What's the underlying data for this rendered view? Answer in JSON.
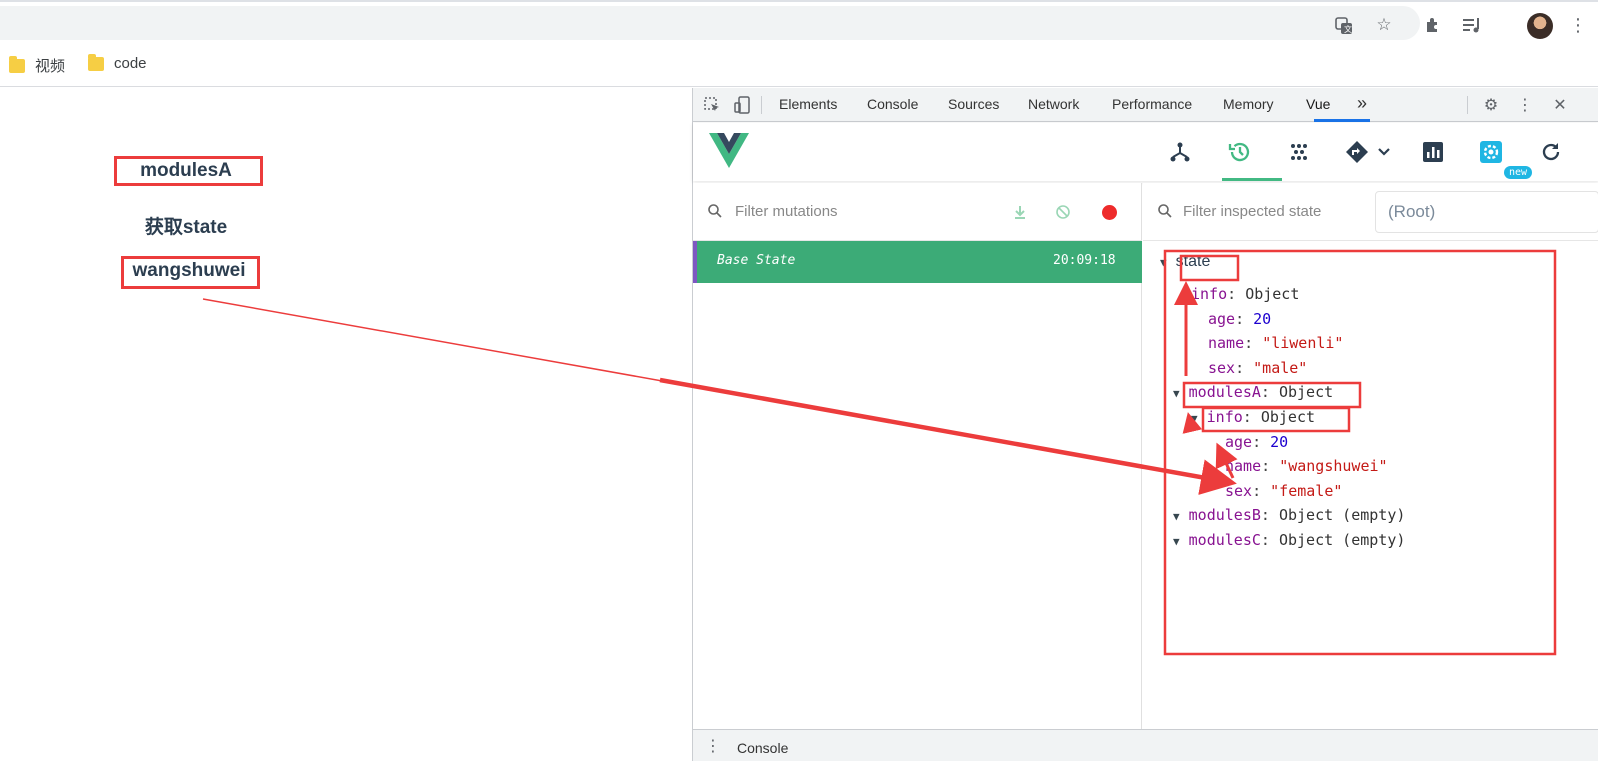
{
  "bookmarks": [
    {
      "label": "视频"
    },
    {
      "label": "code"
    }
  ],
  "page": {
    "module_label": "modulesA",
    "button_label": "获取state",
    "name_value": "wangshuwei"
  },
  "devtools": {
    "tabs": [
      "Elements",
      "Console",
      "Sources",
      "Network",
      "Performance",
      "Memory",
      "Vue"
    ],
    "more_tabs": "»",
    "new_badge": "new",
    "filter_mutations_placeholder": "Filter mutations",
    "filter_state_placeholder": "Filter inspected state",
    "root_label": "(Root)",
    "base_state": {
      "label": "Base State",
      "time": "20:09:18"
    },
    "bottom_drawer_label": "Console"
  },
  "state_tree": {
    "root": "state",
    "info_key": "info",
    "object_label": "Object",
    "info_age_key": "age",
    "info_age": "20",
    "info_name_key": "name",
    "info_name": "\"liwenli\"",
    "info_sex_key": "sex",
    "info_sex": "\"male\"",
    "modulesA_key": "modulesA",
    "modulesA_info_key": "info",
    "a_age_key": "age",
    "a_age": "20",
    "a_name_key": "name",
    "a_name": "\"wangshuwei\"",
    "a_sex_key": "sex",
    "a_sex": "\"female\"",
    "modulesB_key": "modulesB",
    "modulesC_key": "modulesC",
    "empty_object_label": "Object (empty)"
  },
  "colors": {
    "accent": "#42b983",
    "annotation_red": "#ec3c3c",
    "tab_underline": "#1a73e8"
  }
}
